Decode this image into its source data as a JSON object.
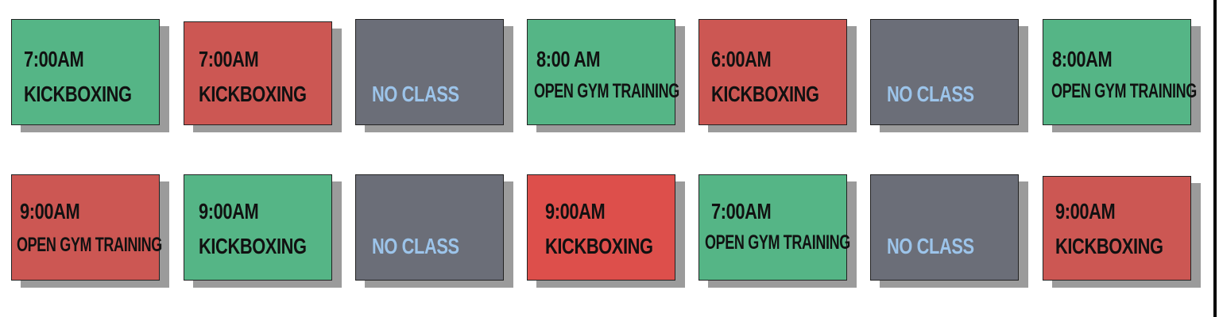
{
  "colors": {
    "green": "#55b586",
    "red": "#cc5753",
    "red_bright": "#dd4f4b",
    "gray": "#6b6e78",
    "no_class_text": "#9cc4ea",
    "shadow": "#9b9b9b"
  },
  "schedule": {
    "row1": [
      {
        "time": "7:00AM",
        "class": "KICKBOXING",
        "color": "green"
      },
      {
        "time": "7:00AM",
        "class": "KICKBOXING",
        "color": "red"
      },
      {
        "time": "",
        "class": "NO CLASS",
        "color": "gray"
      },
      {
        "time": "8:00 AM",
        "class": "OPEN GYM TRAINING",
        "color": "green"
      },
      {
        "time": "6:00AM",
        "class": "KICKBOXING",
        "color": "red"
      },
      {
        "time": "",
        "class": "NO CLASS",
        "color": "gray"
      },
      {
        "time": "8:00AM",
        "class": "OPEN GYM TRAINING",
        "color": "green"
      }
    ],
    "row2": [
      {
        "time": "9:00AM",
        "class": "OPEN GYM TRAINING",
        "color": "red"
      },
      {
        "time": "9:00AM",
        "class": "KICKBOXING",
        "color": "green"
      },
      {
        "time": "",
        "class": "NO CLASS",
        "color": "gray"
      },
      {
        "time": "9:00AM",
        "class": "KICKBOXING",
        "color": "red_bright"
      },
      {
        "time": "7:00AM",
        "class": "OPEN GYM TRAINING",
        "color": "green"
      },
      {
        "time": "",
        "class": "NO CLASS",
        "color": "gray"
      },
      {
        "time": "9:00AM",
        "class": "KICKBOXING",
        "color": "red"
      }
    ]
  }
}
